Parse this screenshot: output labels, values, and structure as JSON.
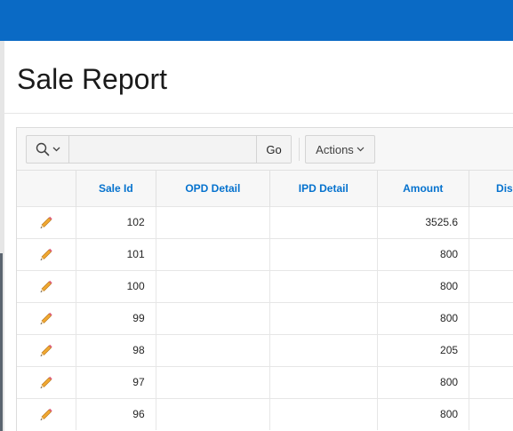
{
  "page": {
    "title": "Sale Report"
  },
  "toolbar": {
    "search_icon": "search-icon",
    "search_value": "",
    "go_label": "Go",
    "actions_label": "Actions"
  },
  "report": {
    "columns": [
      "",
      "Sale Id",
      "OPD Detail",
      "IPD Detail",
      "Amount",
      "Dis"
    ],
    "rows": [
      {
        "sale_id": "102",
        "opd_detail": "",
        "ipd_detail": "",
        "amount": "3525.6",
        "dis": ""
      },
      {
        "sale_id": "101",
        "opd_detail": "",
        "ipd_detail": "",
        "amount": "800",
        "dis": ""
      },
      {
        "sale_id": "100",
        "opd_detail": "",
        "ipd_detail": "",
        "amount": "800",
        "dis": ""
      },
      {
        "sale_id": "99",
        "opd_detail": "",
        "ipd_detail": "",
        "amount": "800",
        "dis": ""
      },
      {
        "sale_id": "98",
        "opd_detail": "",
        "ipd_detail": "",
        "amount": "205",
        "dis": ""
      },
      {
        "sale_id": "97",
        "opd_detail": "",
        "ipd_detail": "",
        "amount": "800",
        "dis": ""
      },
      {
        "sale_id": "96",
        "opd_detail": "",
        "ipd_detail": "",
        "amount": "800",
        "dis": ""
      }
    ]
  },
  "colors": {
    "header_bar": "#0a6ac5",
    "column_header_text": "#0572ce",
    "pencil": "#f0a830"
  }
}
